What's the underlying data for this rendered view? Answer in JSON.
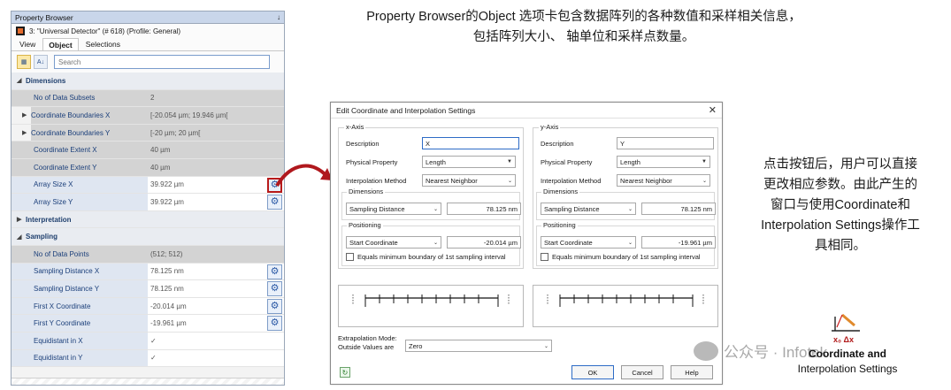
{
  "property_browser": {
    "title": "Property Browser",
    "pin": "↓",
    "object_line": "3: \"Universal Detector\" (# 618) (Profile: General)",
    "tabs": [
      "View",
      "Object",
      "Selections"
    ],
    "search_placeholder": "Search",
    "rows": [
      {
        "kind": "cat",
        "label": "Dimensions",
        "arrow": "◢"
      },
      {
        "kind": "ro",
        "name": "No of Data Subsets",
        "value": "2"
      },
      {
        "kind": "ro",
        "name": "Coordinate Boundaries X",
        "value": "[-20.054 µm; 19.946 µm[",
        "expand": true
      },
      {
        "kind": "ro",
        "name": "Coordinate Boundaries Y",
        "value": "[-20 µm; 20 µm[",
        "expand": true
      },
      {
        "kind": "ro",
        "name": "Coordinate Extent X",
        "value": "40 µm"
      },
      {
        "kind": "ro",
        "name": "Coordinate Extent Y",
        "value": "40 µm"
      },
      {
        "kind": "rw",
        "name": "Array Size X",
        "value": "39.922 µm",
        "gear": true,
        "highlight": true
      },
      {
        "kind": "rw",
        "name": "Array Size Y",
        "value": "39.922 µm",
        "gear": true
      },
      {
        "kind": "cat",
        "label": "Interpretation",
        "arrow": "▶"
      },
      {
        "kind": "cat",
        "label": "Sampling",
        "arrow": "◢"
      },
      {
        "kind": "ro",
        "name": "No of Data Points",
        "value": "(512; 512)"
      },
      {
        "kind": "rw",
        "name": "Sampling Distance X",
        "value": "78.125 nm",
        "gear": true
      },
      {
        "kind": "rw",
        "name": "Sampling Distance Y",
        "value": "78.125 nm",
        "gear": true
      },
      {
        "kind": "rw",
        "name": "First X Coordinate",
        "value": "-20.014 µm",
        "gear": true
      },
      {
        "kind": "rw",
        "name": "First Y Coordinate",
        "value": "-19.961 µm",
        "gear": true
      },
      {
        "kind": "rw",
        "name": "Equidistant in X",
        "value": "✓"
      },
      {
        "kind": "rw",
        "name": "Equidistant in Y",
        "value": "✓"
      }
    ]
  },
  "dialog": {
    "title": "Edit Coordinate and Interpolation Settings",
    "close": "✕",
    "x_axis": {
      "label": "x-Axis",
      "description_label": "Description",
      "description": "X",
      "physical_property_label": "Physical Property",
      "physical_property": "Length",
      "interpolation_label": "Interpolation Method",
      "interpolation": "Nearest Neighbor",
      "dimensions_label": "Dimensions",
      "dimensions_mode": "Sampling Distance",
      "dimensions_value": "78.125 nm",
      "positioning_label": "Positioning",
      "positioning_mode": "Start Coordinate",
      "positioning_value": "-20.014 µm",
      "checkbox_label": "Equals minimum boundary of 1st sampling interval"
    },
    "y_axis": {
      "label": "y-Axis",
      "description_label": "Description",
      "description": "Y",
      "physical_property_label": "Physical Property",
      "physical_property": "Length",
      "interpolation_label": "Interpolation Method",
      "interpolation": "Nearest Neighbor",
      "dimensions_label": "Dimensions",
      "dimensions_mode": "Sampling Distance",
      "dimensions_value": "78.125 nm",
      "positioning_label": "Positioning",
      "positioning_mode": "Start Coordinate",
      "positioning_value": "-19.961 µm",
      "checkbox_label": "Equals minimum boundary of 1st sampling interval"
    },
    "extrapolation_line1": "Extrapolation Mode:",
    "extrapolation_line2": "Outside Values are",
    "extrapolation_value": "Zero",
    "ok": "OK",
    "cancel": "Cancel",
    "help": "Help"
  },
  "annotations": {
    "top_line1": "Property Browser的Object 选项卡包含数据阵列的各种数值和采样相关信息，",
    "top_line2": "包括阵列大小、 轴单位和采样点数量。",
    "right_lines": [
      "点击按钮后，用户可以直接",
      "更改相应参数。由此产生的",
      "窗口与使用Coordinate和",
      "Interpolation Settings操作工",
      "具相同。"
    ],
    "tool_label_line1": "Coordinate and",
    "tool_label_line2": "Interpolation Settings",
    "tool_icon_text": "x₀ Δx",
    "watermark": "公众号 · Infotek"
  }
}
